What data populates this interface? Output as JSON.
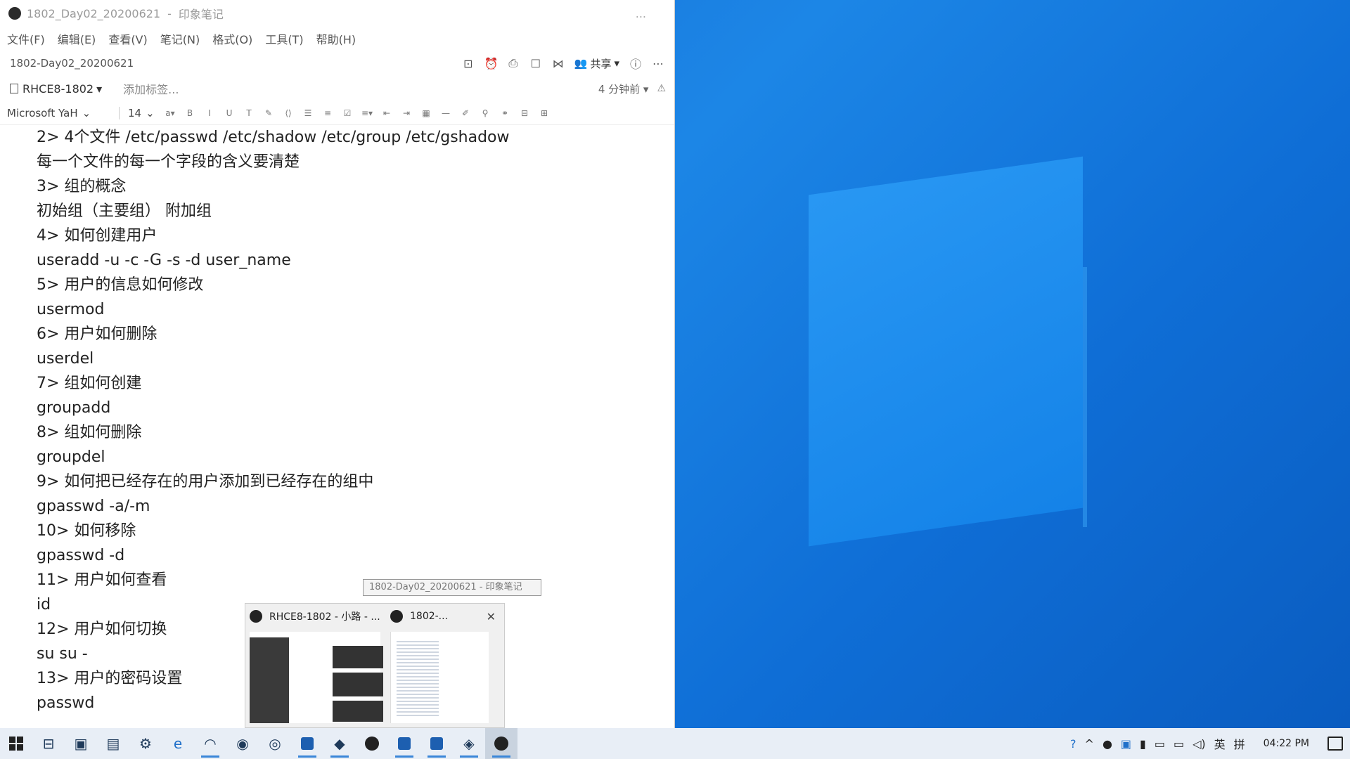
{
  "window": {
    "title": "1802_Day02_20200621",
    "app_name": "印象笔记",
    "more": "..."
  },
  "menu": [
    "文件(F)",
    "编辑(E)",
    "查看(V)",
    "笔记(N)",
    "格式(O)",
    "工具(T)",
    "帮助(H)"
  ],
  "doc": {
    "name": "1802-Day02_20200621",
    "share_label": "共享"
  },
  "tags": {
    "notebook": "RHCE8-1802",
    "add_tag": "添加标签...",
    "time_ago": "4 分钟前"
  },
  "format": {
    "font": "Microsoft YaH",
    "size": "14"
  },
  "content_lines": [
    "2> 4个文件 /etc/passwd /etc/shadow /etc/group /etc/gshadow",
    "每一个文件的每一个字段的含义要清楚",
    "3> 组的概念",
    "初始组（主要组） 附加组",
    "4> 如何创建用户",
    "useradd -u -c -G -s -d user_name",
    "5> 用户的信息如何修改",
    "usermod",
    "6> 用户如何删除",
    "userdel",
    "7> 组如何创建",
    "groupadd",
    "8> 组如何删除",
    "groupdel",
    "9> 如何把已经存在的用户添加到已经存在的组中",
    "gpasswd -a/-m",
    "10> 如何移除",
    "gpasswd -d",
    "11> 用户如何查看",
    "id",
    "12> 用户如何切换",
    "su su -",
    "13> 用户的密码设置",
    "passwd"
  ],
  "tooltip": "1802-Day02_20200621 - 印象笔记",
  "thumbnails": [
    {
      "title": "RHCE8-1802 - 小路 - ..."
    },
    {
      "title": "1802-..."
    }
  ],
  "taskbar": {
    "clock": "04:22 PM",
    "ime_lang": "英",
    "ime_mode": "拼"
  }
}
